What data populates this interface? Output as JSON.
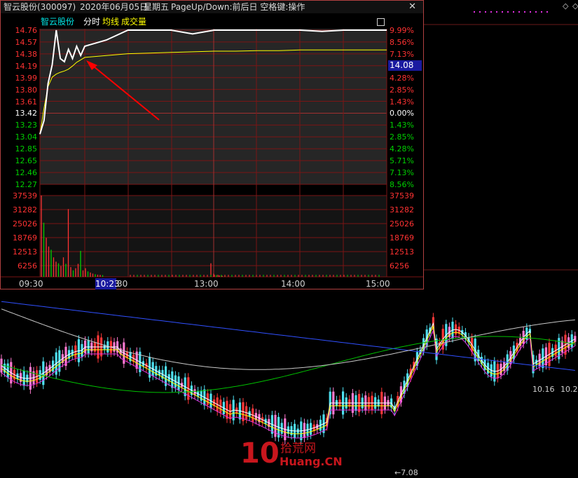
{
  "title": {
    "stock": "智云股份(300097)",
    "date": "2020年06月05日",
    "weekday": "星期五",
    "hint": "PageUp/Down:前后日 空格键:操作",
    "close": "✕"
  },
  "legend": {
    "stock_name": "智云股份",
    "fenshi": "分时",
    "junxian": "均线",
    "volume": "成交量"
  },
  "colors": {
    "up": "#ff3232",
    "down": "#00d000",
    "flat": "#ffffff",
    "price_line": "#ffffff",
    "avg_line": "#ffff00",
    "grid": "#7a1515",
    "cyan": "#00e5e5",
    "arrow": "#ff0000"
  },
  "left_axis": [
    {
      "v": "14.76",
      "c": "up"
    },
    {
      "v": "14.57",
      "c": "up"
    },
    {
      "v": "14.38",
      "c": "up"
    },
    {
      "v": "14.19",
      "c": "up"
    },
    {
      "v": "13.99",
      "c": "up"
    },
    {
      "v": "13.80",
      "c": "up"
    },
    {
      "v": "13.61",
      "c": "up"
    },
    {
      "v": "13.42",
      "c": "flat"
    },
    {
      "v": "13.23",
      "c": "down"
    },
    {
      "v": "13.04",
      "c": "down"
    },
    {
      "v": "12.85",
      "c": "down"
    },
    {
      "v": "12.65",
      "c": "down"
    },
    {
      "v": "12.46",
      "c": "down"
    },
    {
      "v": "12.27",
      "c": "down"
    }
  ],
  "right_axis": [
    {
      "v": "9.99%",
      "c": "up"
    },
    {
      "v": "8.56%",
      "c": "up"
    },
    {
      "v": "7.13%",
      "c": "up"
    },
    {
      "v": "",
      "c": "up"
    },
    {
      "v": "4.28%",
      "c": "up"
    },
    {
      "v": "2.85%",
      "c": "up"
    },
    {
      "v": "1.43%",
      "c": "up"
    },
    {
      "v": "0.00%",
      "c": "flat"
    },
    {
      "v": "1.43%",
      "c": "down"
    },
    {
      "v": "2.85%",
      "c": "down"
    },
    {
      "v": "4.28%",
      "c": "down"
    },
    {
      "v": "5.71%",
      "c": "down"
    },
    {
      "v": "7.13%",
      "c": "down"
    },
    {
      "v": "8.56%",
      "c": "down"
    }
  ],
  "current_price_tag": "14.08",
  "volume_axis": [
    "37539",
    "31282",
    "25026",
    "18769",
    "12513",
    "6256"
  ],
  "time_axis": [
    "09:30",
    "10:23",
    "30",
    "13:00",
    "14:00",
    "15:00"
  ],
  "cursor_time": "10:23",
  "kline_labels": {
    "low_price": "7.08",
    "ma_a": "10.16",
    "ma_b": "10.2"
  },
  "watermark": {
    "num": "10",
    "cn": "拾荒网",
    "en": "Huang.CN"
  },
  "chart_data": [
    {
      "type": "line",
      "title": "智云股份(300097) 2020年06月05日 分时",
      "prev_close": 13.42,
      "ylim": [
        12.27,
        14.76
      ],
      "x_ticks": [
        "09:30",
        "10:30",
        "13:00",
        "14:00",
        "15:00"
      ],
      "series": [
        {
          "name": "分时",
          "values": [
            13.08,
            13.3,
            13.9,
            14.2,
            14.76,
            14.3,
            14.25,
            14.45,
            14.3,
            14.5,
            14.35,
            14.5,
            14.6,
            14.76,
            14.76,
            14.76,
            14.7,
            14.76,
            14.76,
            14.76,
            14.76,
            14.76,
            14.74,
            14.76,
            14.76,
            14.76
          ]
        },
        {
          "name": "均线",
          "values": [
            13.08,
            13.5,
            13.85,
            14.0,
            14.05,
            14.08,
            14.1,
            14.13,
            14.18,
            14.24,
            14.28,
            14.32,
            14.35,
            14.38,
            14.39,
            14.4,
            14.41,
            14.42,
            14.42,
            14.43,
            14.43,
            14.44,
            14.44,
            14.44,
            14.44,
            14.44
          ]
        }
      ]
    },
    {
      "type": "bar",
      "title": "成交量",
      "ylim": [
        0,
        37539
      ],
      "series": [
        {
          "name": "成交量",
          "values": [
            37539,
            25000,
            18000,
            14000,
            12513,
            9000,
            7000,
            6256,
            5000,
            9000,
            6000,
            31282,
            4500,
            3000,
            4000,
            6000,
            12000,
            3000,
            4000,
            2500,
            2000,
            1500,
            1200,
            1000,
            900,
            800,
            6256,
            1500,
            800,
            700,
            500,
            400
          ]
        }
      ]
    }
  ]
}
